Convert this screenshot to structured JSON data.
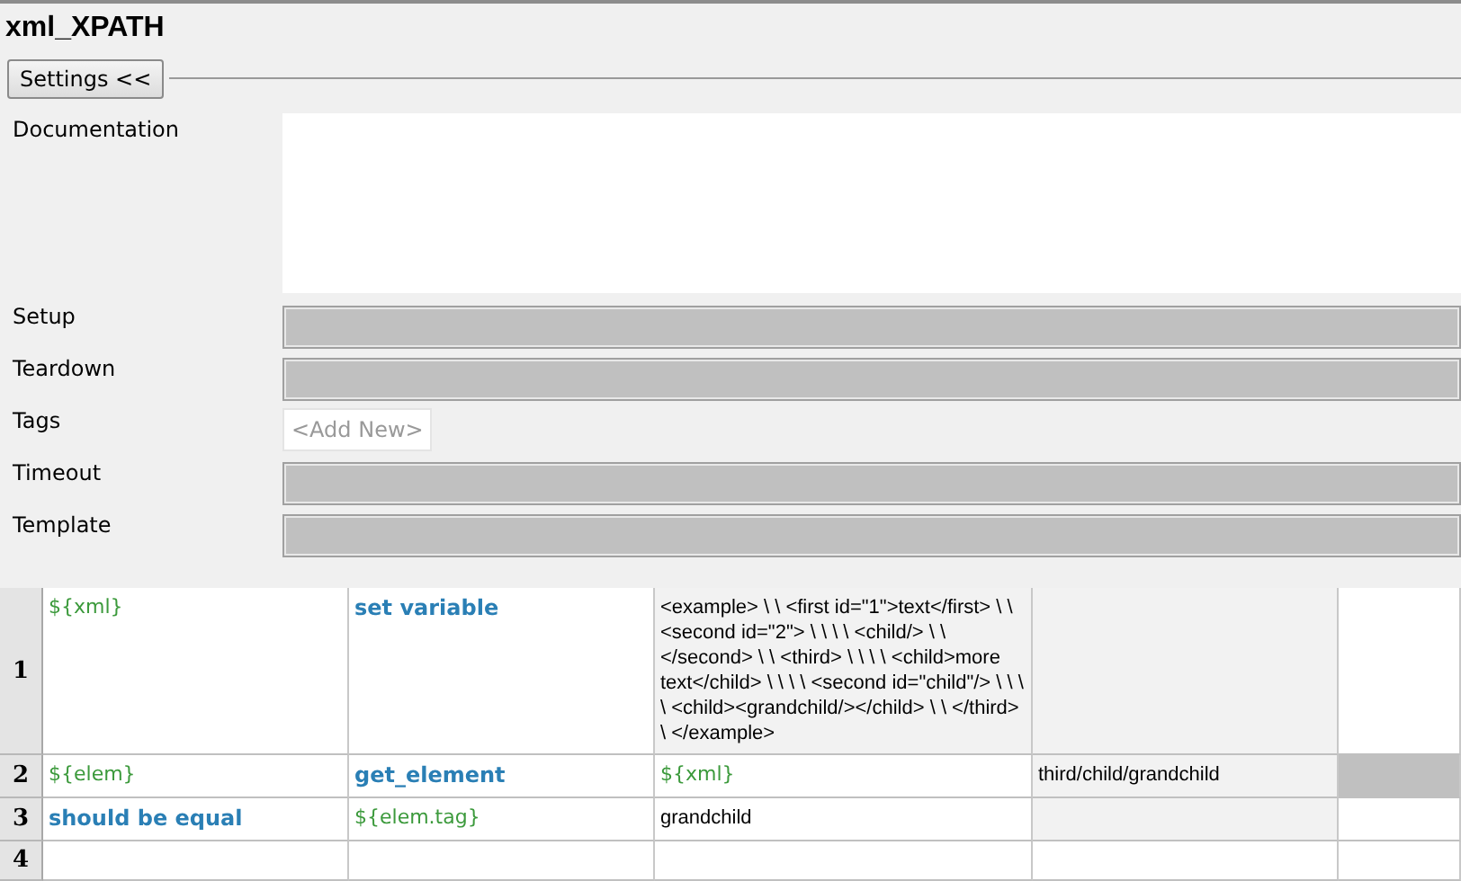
{
  "title": "xml_XPATH",
  "settings_button": "Settings <<",
  "settings": [
    {
      "kind": "doc",
      "label": "Documentation"
    },
    {
      "kind": "field",
      "label": "Setup",
      "disabled": true
    },
    {
      "kind": "field",
      "label": "Teardown",
      "disabled": true
    },
    {
      "kind": "tags",
      "label": "Tags",
      "add_new": "<Add New>"
    },
    {
      "kind": "field",
      "label": "Timeout",
      "disabled": true
    },
    {
      "kind": "field",
      "label": "Template",
      "disabled": true
    }
  ],
  "table": {
    "rows": [
      {
        "number": "1",
        "cells": [
          {
            "kind": "variable",
            "text": "${xml}",
            "color": "#ffffff"
          },
          {
            "kind": "keyword",
            "text": "set variable",
            "color": "#ffffff"
          },
          {
            "kind": "text",
            "text": "<example> \\ \\ <first id=\"1\">text</first> \\ \\ <second id=\"2\"> \\ \\ \\ \\ <child/> \\ \\ </second> \\ \\ <third> \\ \\ \\ \\ <child>more text</child> \\ \\ \\ \\ <second id=\"child\"/> \\ \\ \\ \\ <child><grandchild/></child> \\ \\ </third> \\ </example>",
            "color": "#f2f2f2"
          },
          {
            "kind": "empty",
            "color": "#f2f2f2"
          },
          {
            "kind": "empty",
            "color": "#ffffff"
          }
        ]
      },
      {
        "number": "2",
        "cells": [
          {
            "kind": "variable",
            "text": "${elem}",
            "color": "#ffffff"
          },
          {
            "kind": "keyword",
            "text": "get_element",
            "color": "#ffffff"
          },
          {
            "kind": "variable",
            "text": "${xml}",
            "color": "#ffffff"
          },
          {
            "kind": "text",
            "text": "third/child/grandchild",
            "color": "#f2f2f2"
          },
          {
            "kind": "empty",
            "color": "#c0c0c0"
          }
        ]
      },
      {
        "number": "3",
        "cells": [
          {
            "kind": "keyword",
            "text": "should be equal",
            "color": "#ffffff"
          },
          {
            "kind": "variable",
            "text": "${elem.tag}",
            "color": "#ffffff"
          },
          {
            "kind": "text",
            "text": "grandchild",
            "color": "#ffffff"
          },
          {
            "kind": "empty",
            "color": "#f2f2f2"
          },
          {
            "kind": "empty",
            "color": "#ffffff"
          }
        ]
      },
      {
        "number": "4",
        "cells": [
          {
            "kind": "empty",
            "color": "#ffffff"
          },
          {
            "kind": "empty",
            "color": "#ffffff"
          },
          {
            "kind": "empty",
            "color": "#ffffff"
          },
          {
            "kind": "empty",
            "color": "#ffffff"
          },
          {
            "kind": "empty",
            "color": "#ffffff"
          }
        ]
      }
    ]
  }
}
